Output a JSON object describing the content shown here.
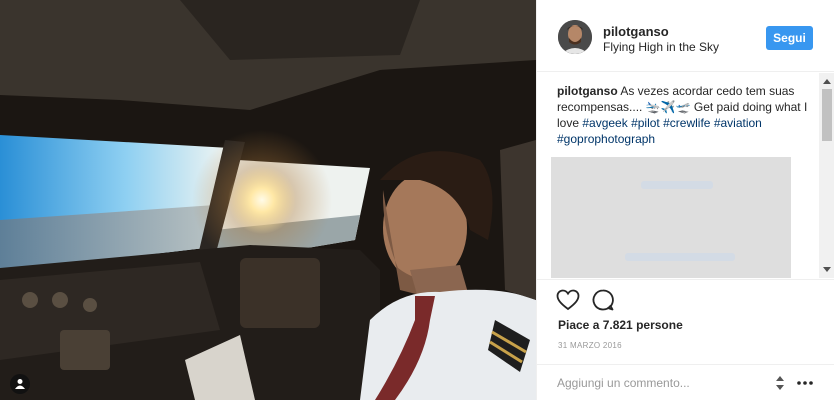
{
  "post": {
    "username": "pilotganso",
    "location": "Flying High in the Sky",
    "follow_label": "Segui",
    "caption": {
      "username": "pilotganso",
      "text_1": "As vezes acordar cedo tem suas recompensas.... ",
      "emoji": "🛬✈️🛫",
      "text_2": " Get paid doing what I love ",
      "hashtags": [
        "#avgeek",
        "#pilot",
        "#crewlife",
        "#aviation",
        "#goprophotograph"
      ]
    },
    "likes": "Piace a 7.821 persone",
    "date": "31 MARZO 2016",
    "comment_placeholder": "Aggiungi un commento..."
  },
  "icons": {
    "like": "heart-icon",
    "comment": "speech-bubble-icon",
    "user_tag": "person-icon",
    "more": "more-options-icon",
    "spinner": "up-down-arrows-icon"
  },
  "colors": {
    "follow_button": "#3897f0",
    "hashtag": "#003569",
    "text": "#262626",
    "muted": "#999999"
  }
}
